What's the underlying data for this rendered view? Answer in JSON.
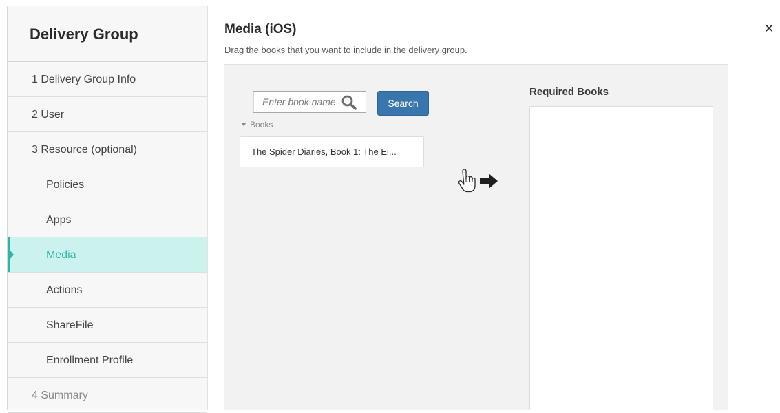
{
  "sidebar": {
    "title": "Delivery Group",
    "items": [
      {
        "label": "1  Delivery Group Info"
      },
      {
        "label": "2  User"
      },
      {
        "label": "3  Resource (optional)"
      },
      {
        "label": "Policies"
      },
      {
        "label": "Apps"
      },
      {
        "label": "Media"
      },
      {
        "label": "Actions"
      },
      {
        "label": "ShareFile"
      },
      {
        "label": "Enrollment Profile"
      },
      {
        "label": "4  Summary"
      }
    ],
    "active_item": "Media"
  },
  "main": {
    "title": "Media (iOS)",
    "subtitle": "Drag the books that you want to include in the delivery group.",
    "search": {
      "placeholder": "Enter book name",
      "value": "",
      "button_label": "Search"
    },
    "books_group_label": "Books",
    "books": [
      {
        "label": "The Spider Diaries, Book 1: The Ei..."
      }
    ],
    "required_title": "Required Books",
    "required_books": []
  },
  "icons": {
    "close": "close-icon",
    "search": "search-icon",
    "drag": "hand-pointer-icon",
    "arrow": "arrow-right-icon"
  },
  "colors": {
    "accent": "#2fb5a6",
    "active_bg": "#ccf2ee",
    "button": "#3a76ae"
  }
}
